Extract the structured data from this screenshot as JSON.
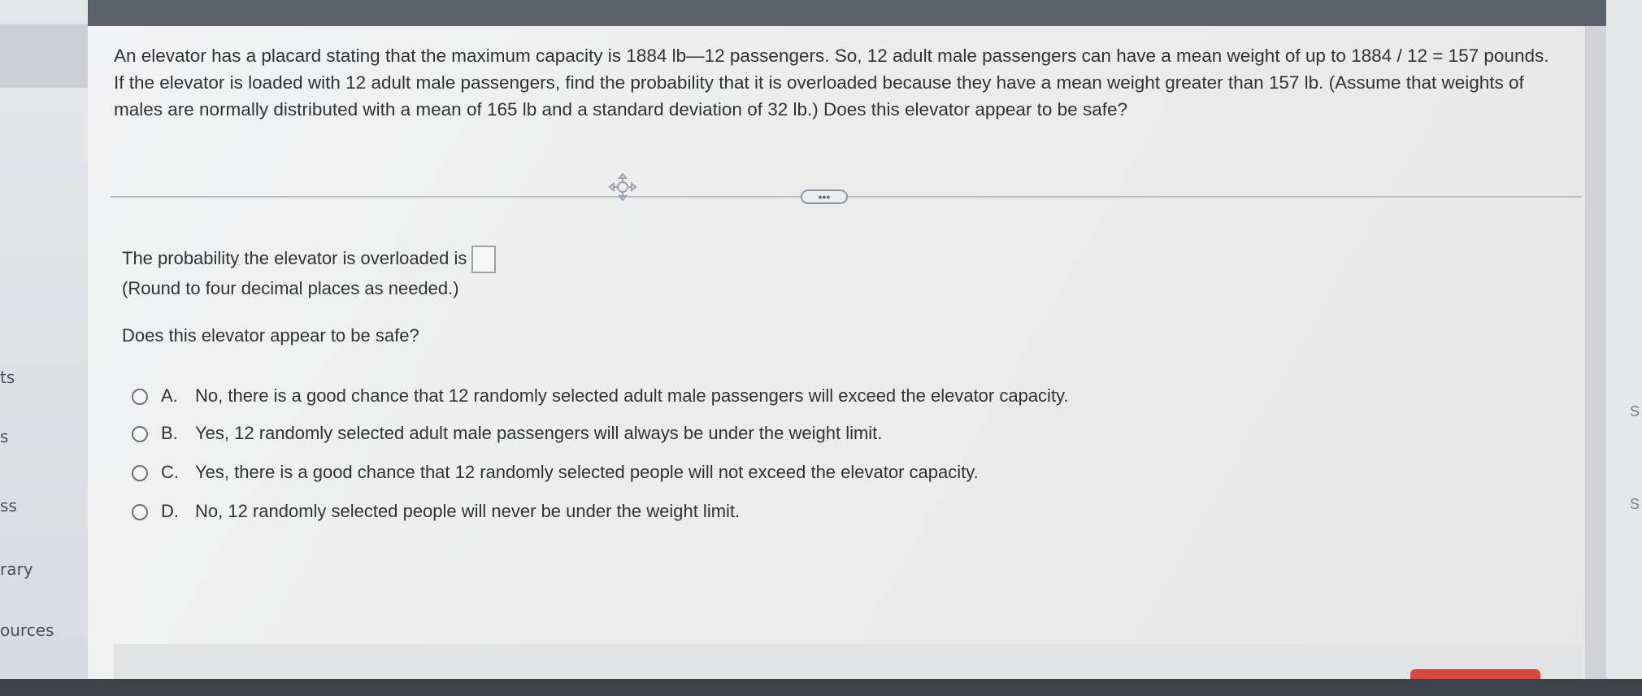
{
  "sidebar": {
    "items": [
      "ts",
      "s",
      "ss",
      "rary",
      "ources"
    ]
  },
  "question": {
    "text": "An elevator has a placard stating that the maximum capacity is 1884 lb—12 passengers. So, 12 adult male passengers can have a mean weight of up to 1884 / 12 = 157 pounds. If the elevator is loaded with 12 adult male passengers, find the probability that it is overloaded because they have a mean weight greater than 157 lb. (Assume that weights of males are normally distributed with a mean of 165 lb and a standard deviation of 32 lb.) Does this elevator appear to be safe?"
  },
  "more_button": {
    "label": "•••"
  },
  "answer": {
    "prompt": "The probability the elevator is overloaded is",
    "value": "",
    "hint": "(Round to four decimal places as needed.)"
  },
  "safety_question": "Does this elevator appear to be safe?",
  "options": [
    {
      "letter": "A.",
      "text": "No, there is a good chance that 12 randomly selected adult male passengers will exceed the elevator capacity."
    },
    {
      "letter": "B.",
      "text": "Yes, 12 randomly selected adult male passengers will always be under the weight limit."
    },
    {
      "letter": "C.",
      "text": "Yes, there is a good chance that 12 randomly selected people will not exceed the elevator capacity."
    },
    {
      "letter": "D.",
      "text": "No, 12 randomly selected people will never be under the weight limit."
    }
  ],
  "right_edge": {
    "letters": [
      "S",
      "S"
    ]
  },
  "colors": {
    "accent_button_border": "#8a96a6",
    "bottom_red": "#d8483f"
  }
}
